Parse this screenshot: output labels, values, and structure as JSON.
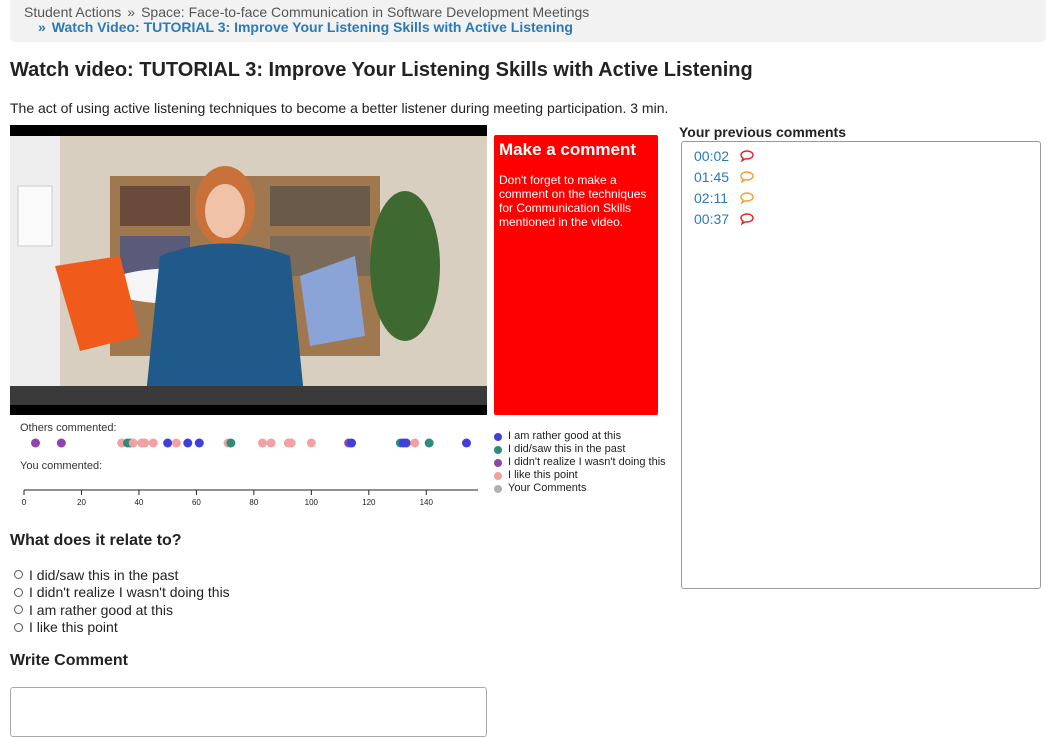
{
  "breadcrumb": {
    "item1": "Student Actions",
    "sep1": "»",
    "item2": "Space: Face-to-face Communication in Software Development Meetings",
    "sep2": "»",
    "item3": "Watch Video: TUTORIAL 3: Improve Your Listening Skills with Active Listening"
  },
  "page": {
    "title": "Watch video: TUTORIAL 3: Improve Your Listening Skills with Active Listening",
    "description": "The act of using active listening techniques to become a better listener during meeting participation. 3 min."
  },
  "comment_box": {
    "heading": "Make a comment",
    "body": "Don't forget to make a comment on the techniques for Communication Skills mentioned in the video.",
    "color": "#ff0000"
  },
  "timeline": {
    "others_label": "Others commented:",
    "you_label": "You commented:",
    "axis_ticks": [
      0,
      20,
      40,
      60,
      80,
      100,
      120,
      140
    ],
    "axis_max": 158,
    "points": [
      {
        "t": 4,
        "c": "#8e44ad"
      },
      {
        "t": 13,
        "c": "#8e44ad"
      },
      {
        "t": 34,
        "c": "#f1a1a1"
      },
      {
        "t": 36,
        "c": "#2e8b7a"
      },
      {
        "t": 37,
        "c": "#2e8b7a"
      },
      {
        "t": 38,
        "c": "#f1a1a1"
      },
      {
        "t": 41,
        "c": "#f1a1a1"
      },
      {
        "t": 42,
        "c": "#f1a1a1"
      },
      {
        "t": 45,
        "c": "#f1a1a1"
      },
      {
        "t": 50,
        "c": "#3f3fe0"
      },
      {
        "t": 53,
        "c": "#f1a1a1"
      },
      {
        "t": 57,
        "c": "#3f3fe0"
      },
      {
        "t": 61,
        "c": "#3f3fe0"
      },
      {
        "t": 71,
        "c": "#f1a1a1"
      },
      {
        "t": 72,
        "c": "#2e8b7a"
      },
      {
        "t": 83,
        "c": "#f1a1a1"
      },
      {
        "t": 86,
        "c": "#f1a1a1"
      },
      {
        "t": 92,
        "c": "#f1a1a1"
      },
      {
        "t": 93,
        "c": "#f1a1a1"
      },
      {
        "t": 100,
        "c": "#f1a1a1"
      },
      {
        "t": 113,
        "c": "#8e44ad"
      },
      {
        "t": 114,
        "c": "#3f3fe0"
      },
      {
        "t": 131,
        "c": "#2e8b7a"
      },
      {
        "t": 132,
        "c": "#3f3fe0"
      },
      {
        "t": 133,
        "c": "#3f3fe0"
      },
      {
        "t": 136,
        "c": "#f1a1a1"
      },
      {
        "t": 141,
        "c": "#2e8b7a"
      },
      {
        "t": 154,
        "c": "#3f3fe0"
      }
    ]
  },
  "legend": [
    {
      "label": "I am rather good at this",
      "color": "#3f3fe0"
    },
    {
      "label": "I did/saw this in the past",
      "color": "#2e8b7a"
    },
    {
      "label": "I didn't realize I wasn't doing this",
      "color": "#8e44ad"
    },
    {
      "label": "I like this point",
      "color": "#f1a1a1"
    },
    {
      "label": "Your Comments",
      "color": "#b0b0b0"
    }
  ],
  "previous": {
    "label": "Your previous comments",
    "items": [
      {
        "time": "00:02",
        "icon": "speech-bubble-icon",
        "color": "#e02020"
      },
      {
        "time": "01:45",
        "icon": "speech-bubble-icon",
        "color": "#f39c2b"
      },
      {
        "time": "02:11",
        "icon": "speech-bubble-icon",
        "color": "#f39c2b"
      },
      {
        "time": "00:37",
        "icon": "speech-bubble-icon",
        "color": "#e02020"
      }
    ]
  },
  "relate": {
    "heading": "What does it relate to?",
    "options": [
      "I did/saw this in the past",
      "I didn't realize I wasn't doing this",
      "I am rather good at this",
      "I like this point"
    ]
  },
  "write": {
    "heading": "Write Comment",
    "value": ""
  }
}
